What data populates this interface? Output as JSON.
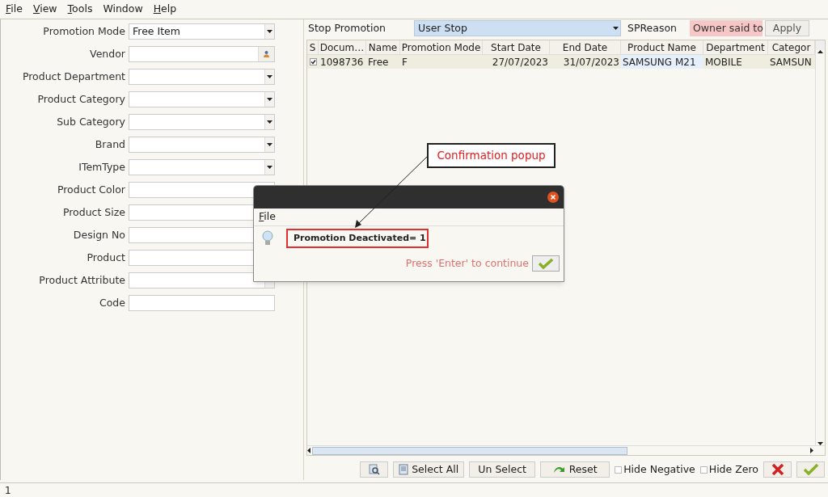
{
  "menu": [
    {
      "label": "File",
      "underlined": true
    },
    {
      "label": "View",
      "underlined": true
    },
    {
      "label": "Tools",
      "underlined": true
    },
    {
      "label": "Window",
      "underlined": false
    },
    {
      "label": "Help",
      "underlined": true
    }
  ],
  "filters": [
    {
      "label": "Promotion Mode",
      "kind": "dropdown",
      "value": "Free Item"
    },
    {
      "label": "Vendor",
      "kind": "lookup"
    },
    {
      "label": "Product Department",
      "kind": "dropdown"
    },
    {
      "label": "Product Category",
      "kind": "dropdown"
    },
    {
      "label": "Sub Category",
      "kind": "dropdown"
    },
    {
      "label": "Brand",
      "kind": "dropdown"
    },
    {
      "label": "ITemType",
      "kind": "dropdown"
    },
    {
      "label": "Product Color",
      "kind": "text"
    },
    {
      "label": "Product Size",
      "kind": "text"
    },
    {
      "label": "Design No",
      "kind": "text"
    },
    {
      "label": "Product",
      "kind": "text"
    },
    {
      "label": "Product Attribute",
      "kind": "dropdown"
    },
    {
      "label": "Code",
      "kind": "text"
    }
  ],
  "stop_bar": {
    "label": "Stop Promotion",
    "mode": "User Stop",
    "reason_label": "SPReason",
    "reason": "Owner said to",
    "apply": "Apply"
  },
  "table": {
    "columns": [
      "S",
      "Docum…",
      "Name",
      "Promotion Mode",
      "Start Date",
      "End Date",
      "Product Name",
      "Department",
      "Categor"
    ],
    "rows": [
      {
        "checked": true,
        "cells": [
          "",
          "1098736",
          "Free",
          "F",
          "27/07/2023",
          "31/07/2023",
          "SAMSUNG M21",
          "MOBILE",
          "SAMSUN"
        ]
      }
    ]
  },
  "footer": {
    "select_all": "Select All",
    "un_select": "Un Select",
    "reset": "Reset",
    "checks": [
      {
        "label": "Hide Negative",
        "checked": false
      },
      {
        "label": "Hide Zero",
        "checked": false
      }
    ]
  },
  "status_bar": "1",
  "callout": "Confirmation popup",
  "dialog": {
    "menu": "File",
    "message": "Promotion Deactivated= 1",
    "hint": "Press 'Enter' to continue"
  }
}
